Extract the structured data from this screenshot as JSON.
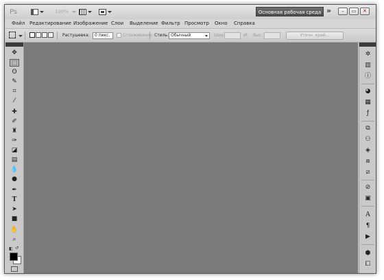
{
  "app": {
    "logo": "Ps",
    "zoom": "100%"
  },
  "titlebar": {
    "workspace_label": "Основная рабочая среда",
    "more_label": "»",
    "minimize": "–",
    "restore": "▭",
    "close": "✕"
  },
  "menu": {
    "items": [
      "Файл",
      "Редактирование",
      "Изображение",
      "Слои",
      "Выделение",
      "Фильтр",
      "Просмотр",
      "Окно",
      "Справка"
    ]
  },
  "options": {
    "feather_label": "Растушевка:",
    "feather_value": "0 пикс.",
    "antialias_label": "Сглаживание",
    "style_label": "Стиль:",
    "style_value": "Обычный",
    "width_label": "Шир.:",
    "height_label": "Выс.:",
    "refine_label": "Уточн. край..."
  },
  "tools": {
    "icons": [
      "move-icon",
      "rect-marquee-icon",
      "lasso-icon",
      "quick-select-icon",
      "crop-icon",
      "eyedropper-icon",
      "spot-heal-icon",
      "brush-icon",
      "clone-stamp-icon",
      "history-brush-icon",
      "eraser-icon",
      "gradient-icon",
      "blur-icon",
      "dodge-icon",
      "pen-icon",
      "type-icon",
      "path-select-icon",
      "rectangle-shape-icon",
      "hand-icon",
      "zoom-icon"
    ],
    "foreground_color": "#000000",
    "background_color": "#ffffff"
  },
  "dock": {
    "icons": [
      "navigator-icon",
      "histogram-icon",
      "info-icon",
      "color-icon",
      "swatches-icon",
      "styles-icon",
      "adjustments-icon",
      "masks-icon",
      "layers-icon",
      "channels-icon",
      "paths-icon",
      "character-icon",
      "paragraph-icon",
      "clone-source-icon",
      "actions-icon",
      "3d-icon"
    ]
  }
}
